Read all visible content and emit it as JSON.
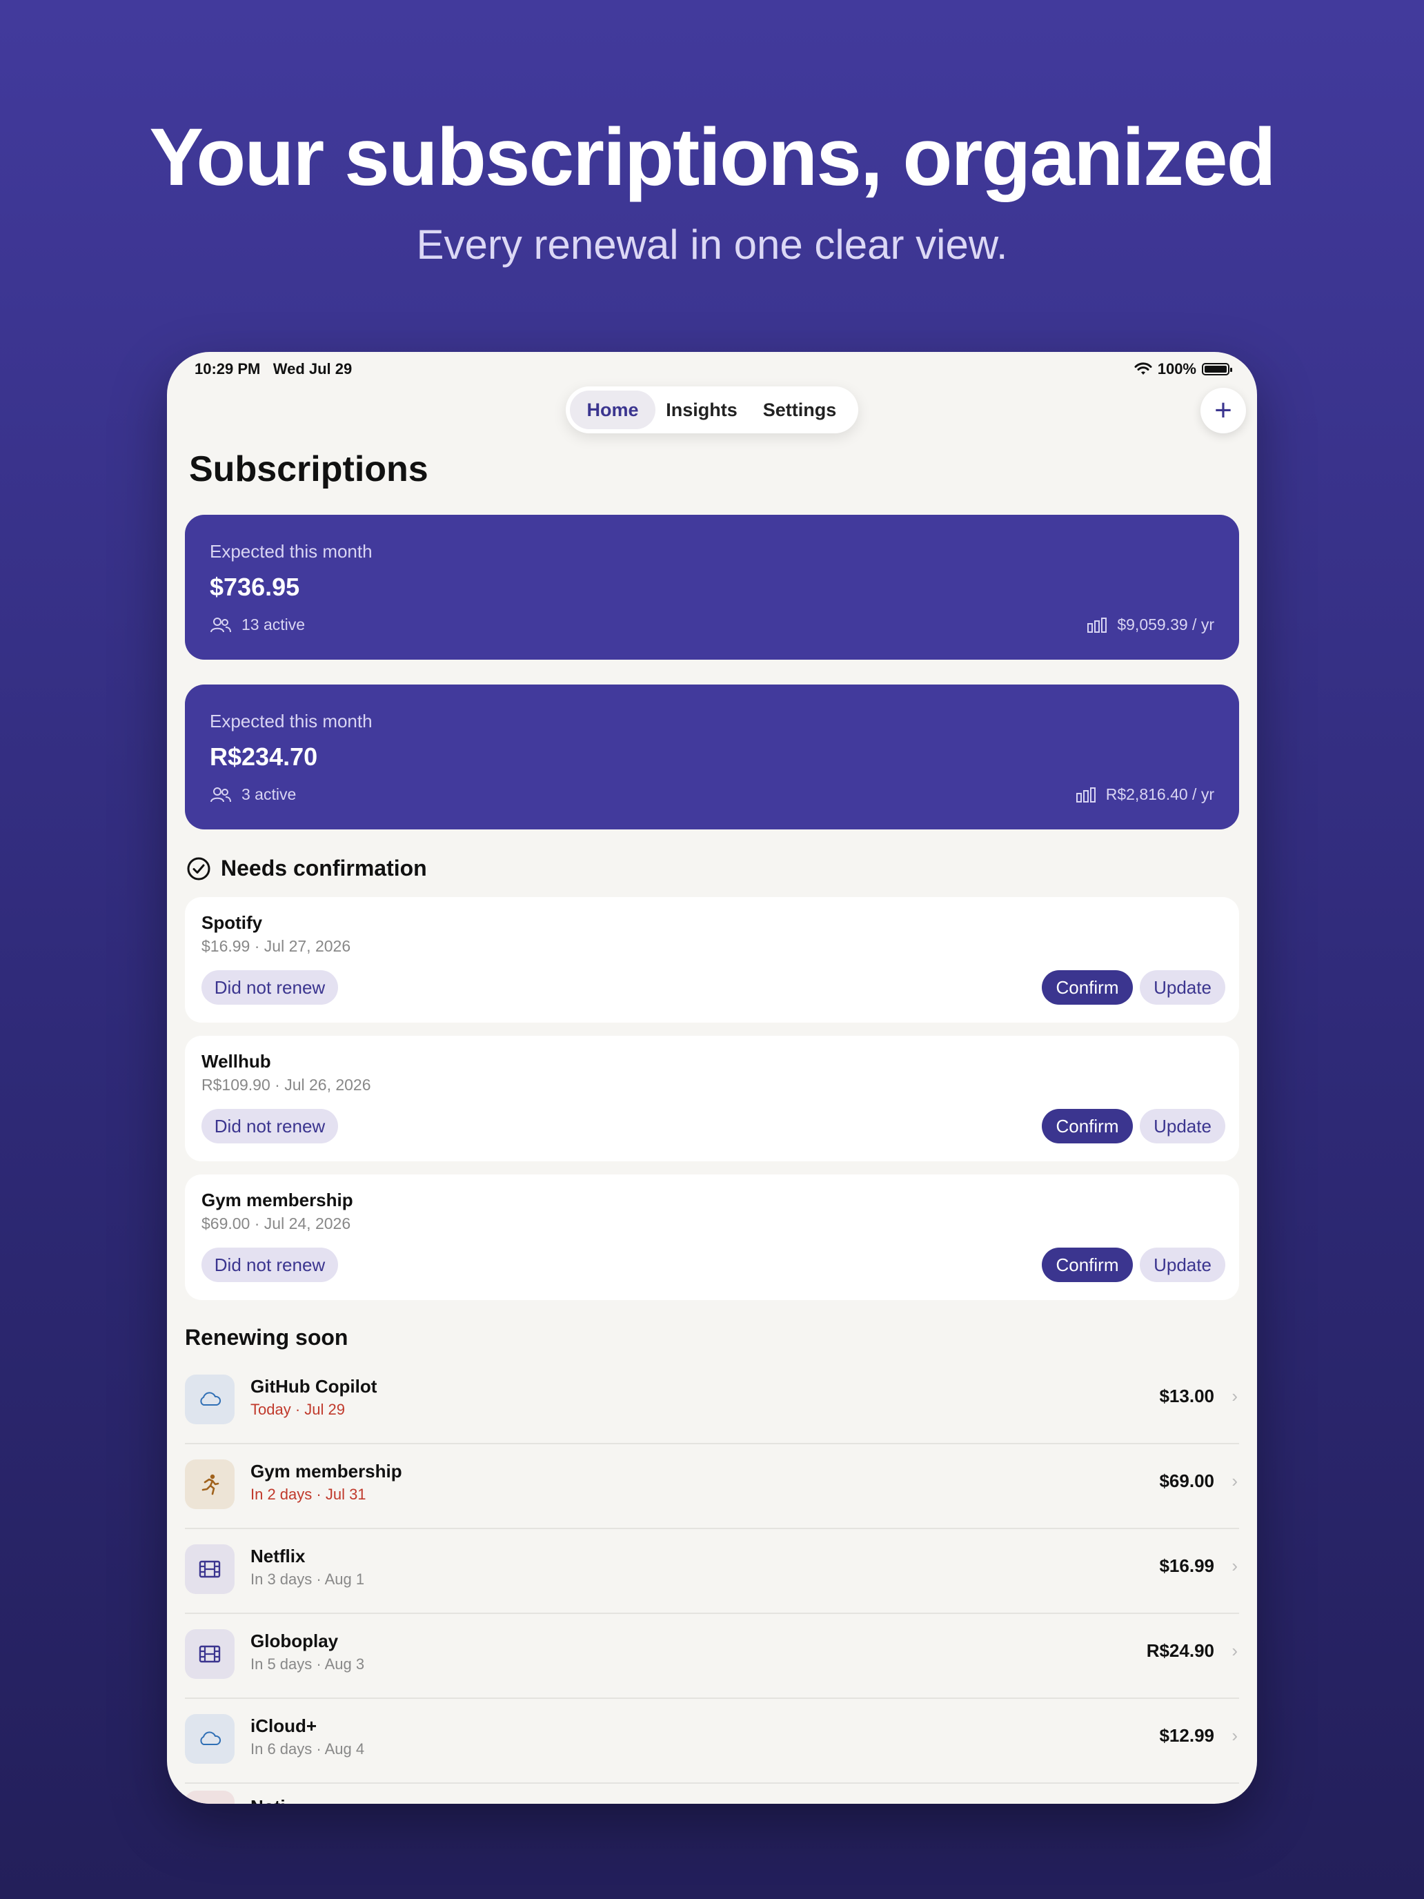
{
  "hero": {
    "title": "Your subscriptions, organized",
    "subtitle": "Every renewal in one clear view."
  },
  "status_bar": {
    "time": "10:29 PM",
    "date": "Wed Jul 29",
    "battery": "100%"
  },
  "tabs": [
    {
      "label": "Home",
      "active": true
    },
    {
      "label": "Insights",
      "active": false
    },
    {
      "label": "Settings",
      "active": false
    }
  ],
  "add_button": "+",
  "page_title": "Subscriptions",
  "summaries": [
    {
      "label": "Expected this month",
      "amount": "$736.95",
      "active": "13 active",
      "yearly": "$9,059.39 / yr"
    },
    {
      "label": "Expected this month",
      "amount": "R$234.70",
      "active": "3 active",
      "yearly": "R$2,816.40 / yr"
    }
  ],
  "needs_confirmation": {
    "title": "Needs confirmation",
    "items": [
      {
        "name": "Spotify",
        "detail": "$16.99 · Jul 27, 2026",
        "did_not_renew": "Did not renew",
        "confirm": "Confirm",
        "update": "Update"
      },
      {
        "name": "Wellhub",
        "detail": "R$109.90 · Jul 26, 2026",
        "did_not_renew": "Did not renew",
        "confirm": "Confirm",
        "update": "Update"
      },
      {
        "name": "Gym membership",
        "detail": "$69.00 · Jul 24, 2026",
        "did_not_renew": "Did not renew",
        "confirm": "Confirm",
        "update": "Update"
      }
    ]
  },
  "renewing_soon": {
    "title": "Renewing soon",
    "items": [
      {
        "name": "GitHub Copilot",
        "when": "Today · Jul 29",
        "urgent": true,
        "price": "$13.00",
        "icon": "cloud-icon"
      },
      {
        "name": "Gym membership",
        "when": "In 2 days · Jul 31",
        "urgent": true,
        "price": "$69.00",
        "icon": "running-icon"
      },
      {
        "name": "Netflix",
        "when": "In 3 days · Aug 1",
        "urgent": false,
        "price": "$16.99",
        "icon": "film-icon"
      },
      {
        "name": "Globoplay",
        "when": "In 5 days · Aug 3",
        "urgent": false,
        "price": "R$24.90",
        "icon": "film-icon"
      },
      {
        "name": "iCloud+",
        "when": "In 6 days · Aug 4",
        "urgent": false,
        "price": "$12.99",
        "icon": "cloud-icon"
      }
    ],
    "partial_next": "Noti"
  },
  "colors": {
    "accent": "#423a9c",
    "urgent": "#c0392b",
    "cloud_tile": "#dfe5ee",
    "running_tile": "#ede4d6",
    "film_tile": "#e4e1ec"
  }
}
